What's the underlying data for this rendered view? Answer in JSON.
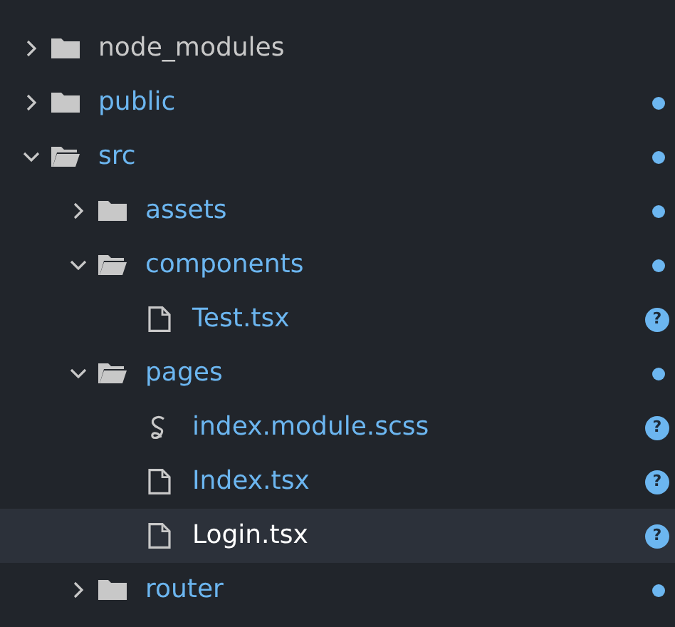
{
  "tree": [
    {
      "name": "node_modules",
      "kind": "folder",
      "expanded": false,
      "selected": false,
      "ignored": true,
      "modified": false
    },
    {
      "name": "public",
      "kind": "folder",
      "expanded": false,
      "selected": false,
      "ignored": false,
      "modified": true
    },
    {
      "name": "src",
      "kind": "folder",
      "expanded": true,
      "selected": false,
      "ignored": false,
      "modified": true,
      "children": [
        {
          "name": "assets",
          "kind": "folder",
          "expanded": false,
          "selected": false,
          "ignored": false,
          "modified": true
        },
        {
          "name": "components",
          "kind": "folder",
          "expanded": true,
          "selected": false,
          "ignored": false,
          "modified": true,
          "children": [
            {
              "name": "Test.tsx",
              "kind": "file",
              "selected": false,
              "ignored": false,
              "modified": false,
              "badge": "?"
            }
          ]
        },
        {
          "name": "pages",
          "kind": "folder",
          "expanded": true,
          "selected": false,
          "ignored": false,
          "modified": true,
          "children": [
            {
              "name": "index.module.scss",
              "kind": "sass",
              "selected": false,
              "ignored": false,
              "modified": false,
              "badge": "?"
            },
            {
              "name": "Index.tsx",
              "kind": "file",
              "selected": false,
              "ignored": false,
              "modified": false,
              "badge": "?"
            },
            {
              "name": "Login.tsx",
              "kind": "file",
              "selected": true,
              "ignored": false,
              "modified": false,
              "badge": "?"
            }
          ]
        },
        {
          "name": "router",
          "kind": "folder",
          "expanded": false,
          "selected": false,
          "ignored": false,
          "modified": true
        }
      ]
    }
  ]
}
